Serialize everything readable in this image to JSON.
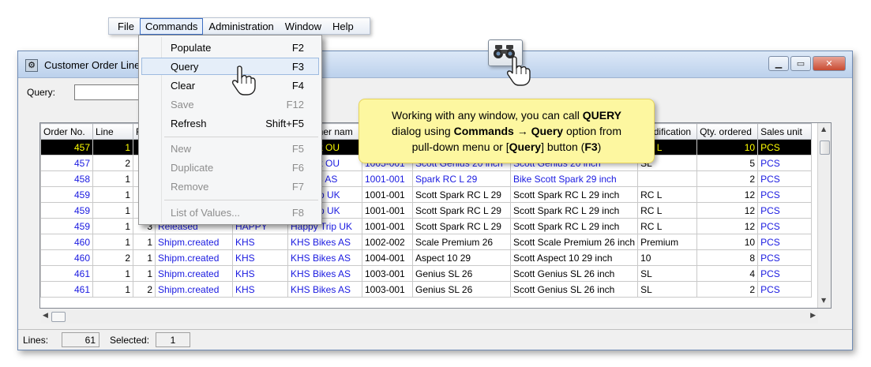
{
  "menubar": {
    "items": [
      "File",
      "Commands",
      "Administration",
      "Window",
      "Help"
    ],
    "active": "Commands"
  },
  "window": {
    "title": "Customer Order Line",
    "icon": "gear-icon",
    "buttons": [
      "minimize-icon",
      "maximize-icon",
      "close-icon"
    ]
  },
  "query": {
    "label": "Query:",
    "value": ""
  },
  "table": {
    "columns": [
      "Order No.",
      "Line",
      "R",
      "",
      "",
      "Customer nam",
      "",
      "",
      "",
      "Modification",
      "Qty. ordered",
      "Sales unit"
    ],
    "rows": [
      [
        "457",
        "1",
        "",
        "",
        "",
        "C Sport OU",
        "",
        "",
        "",
        "RC L",
        "10",
        "PCS"
      ],
      [
        "457",
        "2",
        "",
        "",
        "",
        "C Sport OU",
        "1005-001",
        "Scott Genius 20 inch",
        "Scott Genius 20 inch",
        "SL",
        "5",
        "PCS"
      ],
      [
        "458",
        "1",
        "",
        "",
        "",
        "S Bikes AS",
        "1001-001",
        "Spark RC L 29",
        "Bike Scott Spark 29 inch",
        "",
        "2",
        "PCS"
      ],
      [
        "459",
        "1",
        "",
        "",
        "",
        "ppy Trip UK",
        "1001-001",
        "Scott Spark RC L 29",
        "Scott Spark RC L 29 inch",
        "RC L",
        "12",
        "PCS"
      ],
      [
        "459",
        "1",
        "",
        "",
        "",
        "ppy Trip UK",
        "1001-001",
        "Scott Spark RC L 29",
        "Scott Spark RC L 29 inch",
        "RC L",
        "12",
        "PCS"
      ],
      [
        "459",
        "1",
        "3",
        "Released",
        "HAPPY",
        "Happy Trip UK",
        "1001-001",
        "Scott Spark RC L 29",
        "Scott Spark RC L 29 inch",
        "RC L",
        "12",
        "PCS"
      ],
      [
        "460",
        "1",
        "1",
        "Shipm.created",
        "KHS",
        "KHS Bikes AS",
        "1002-002",
        "Scale Premium 26",
        "Scott Scale Premium 26 inch",
        "Premium",
        "10",
        "PCS"
      ],
      [
        "460",
        "2",
        "1",
        "Shipm.created",
        "KHS",
        "KHS Bikes AS",
        "1004-001",
        "Aspect 10 29",
        "Scott Aspect 10 29 inch",
        "10",
        "8",
        "PCS"
      ],
      [
        "461",
        "1",
        "1",
        "Shipm.created",
        "KHS",
        "KHS Bikes AS",
        "1003-001",
        "Genius SL 26",
        "Scott Genius SL 26 inch",
        "SL",
        "4",
        "PCS"
      ],
      [
        "461",
        "1",
        "2",
        "Shipm.created",
        "KHS",
        "KHS Bikes AS",
        "1003-001",
        "Genius SL 26",
        "Scott Genius SL 26 inch",
        "SL",
        "2",
        "PCS"
      ]
    ]
  },
  "status": {
    "lines_label": "Lines:",
    "lines_value": "61",
    "selected_label": "Selected:",
    "selected_value": "1"
  },
  "menu": {
    "items": [
      {
        "label": "Populate",
        "shortcut": "F2",
        "disabled": false
      },
      {
        "label": "Query",
        "shortcut": "F3",
        "disabled": false,
        "hover": true
      },
      {
        "label": "Clear",
        "shortcut": "F4",
        "disabled": false
      },
      {
        "label": "Save",
        "shortcut": "F12",
        "disabled": true
      },
      {
        "label": "Refresh",
        "shortcut": "Shift+F5",
        "disabled": false
      },
      {
        "label": "New",
        "shortcut": "F5",
        "disabled": true
      },
      {
        "label": "Duplicate",
        "shortcut": "F6",
        "disabled": true
      },
      {
        "label": "Remove",
        "shortcut": "F7",
        "disabled": true
      },
      {
        "label": "List of Values...",
        "shortcut": "F8",
        "disabled": true
      }
    ]
  },
  "callout": {
    "line1_a": "Working with any window, you can call ",
    "line1_b": "QUERY",
    "line2_a": "dialog using ",
    "line2_b": "Commands",
    "line2_arrow": " → ",
    "line2_c": "Query",
    "line2_d": " option from",
    "line3_a": "pull-down menu or [",
    "line3_b": "Query",
    "line3_c": "] button (",
    "line3_d": "F3",
    "line3_e": ")"
  },
  "icons": {
    "query_button": "binoculars-icon",
    "pointer": "hand-pointer-icon"
  }
}
